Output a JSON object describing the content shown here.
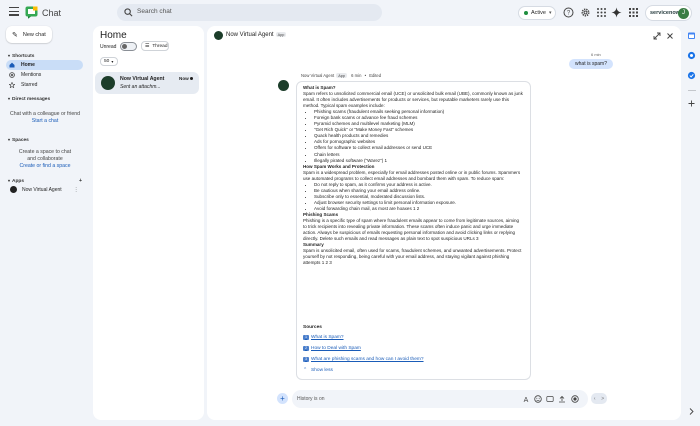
{
  "app": {
    "title": "Chat",
    "accent": "#1a73e8"
  },
  "search": {
    "placeholder": "Search chat"
  },
  "status": {
    "label": "Active",
    "color": "#1e8e3e"
  },
  "account": {
    "brand": "servicenow",
    "avatar_initial": "J"
  },
  "sidebar": {
    "new_chat_label": "New chat",
    "shortcuts_header": "Shortcuts",
    "items": [
      {
        "label": "Home",
        "icon": "home-icon",
        "active": true
      },
      {
        "label": "Mentions",
        "icon": "at-icon",
        "active": false
      },
      {
        "label": "Starred",
        "icon": "star-icon",
        "active": false
      }
    ],
    "direct_messages_header": "Direct messages",
    "dm_hint": "Chat with a colleague or friend",
    "dm_link": "Start a chat",
    "spaces_header": "Spaces",
    "spaces_hint": "Create a space to chat and collaborate",
    "spaces_link": "Create or find a space",
    "apps_header": "Apps",
    "apps": [
      {
        "label": "Now Virtual Agent"
      }
    ]
  },
  "home": {
    "title": "Home",
    "unread_label": "Unread",
    "thread_label": "Thread",
    "size_value": "50",
    "rows": [
      {
        "name": "Now Virtual Agent",
        "time": "Now",
        "preview": "Sent an attachm..."
      }
    ]
  },
  "conversation": {
    "name": "Now Virtual Agent",
    "badge": "App",
    "user_message": {
      "meta": "6 min",
      "text": "what is spam?"
    },
    "bot_meta": {
      "name": "Now Virtual Agent",
      "badge": "App",
      "time": "6 min",
      "edited": "Edited"
    },
    "answer": {
      "q_heading": "What is Spam?",
      "intro": "Spam refers to unsolicited commercial email (UCE) or unsolicited bulk email (UBE), commonly known as junk email. It often includes advertisements for products or services, but reputable marketers rarely use this method. Typical spam examples include:",
      "examples": [
        "Phishing scams (fraudulent emails seeking personal information)",
        "Foreign bank scams or advance fee fraud schemes",
        "Pyramid schemes and multilevel marketing (MLM)",
        "\"Get Rich Quick\" or \"Make Money Fast\" schemes",
        "Quack health products and remedies",
        "Ads for pornographic websites",
        "Offers for software to collect email addresses or send UCE",
        "Chain letters",
        "Illegally pirated software (\"Warez\") 1"
      ],
      "works_heading": "How Spam Works and Protection",
      "works_text": "Spam is a widespread problem, especially for email addresses posted online or in public forums. Spammers use automated programs to collect email addresses and bombard them with spam. To reduce spam:",
      "tips": [
        "Do not reply to spam, as it confirms your address is active.",
        "Be cautious when sharing your email address online.",
        "Subscribe only to essential, moderated discussion lists.",
        "Adjust browser security settings to limit personal information exposure.",
        "Avoid forwarding chain mail, as most are hoaxes 1 2"
      ],
      "phishing_heading": "Phishing Scams",
      "phishing_text": "Phishing is a specific type of spam where fraudulent emails appear to come from legitimate sources, aiming to trick recipients into revealing private information. These scams often induce panic and urge immediate action. Always be suspicious of emails requesting personal information and avoid clicking links or replying directly. Delete such emails and read messages as plain text to spot suspicious URLs 3",
      "summary_heading": "Summary",
      "summary_text": "Spam is unsolicited email, often used for scams, fraudulent schemes, and unwanted advertisements. Protect yourself by not responding, being careful with your email address, and staying vigilant against phishing attempts 1 2 3"
    },
    "sources_heading": "Sources",
    "sources": [
      {
        "num": "1",
        "label": "What is Spam?"
      },
      {
        "num": "2",
        "label": "How to Deal with Spam"
      },
      {
        "num": "3",
        "label": "What are phishing scams and how can I avoid them?"
      }
    ],
    "show_less": "Show less",
    "compose_placeholder": "History is on"
  }
}
